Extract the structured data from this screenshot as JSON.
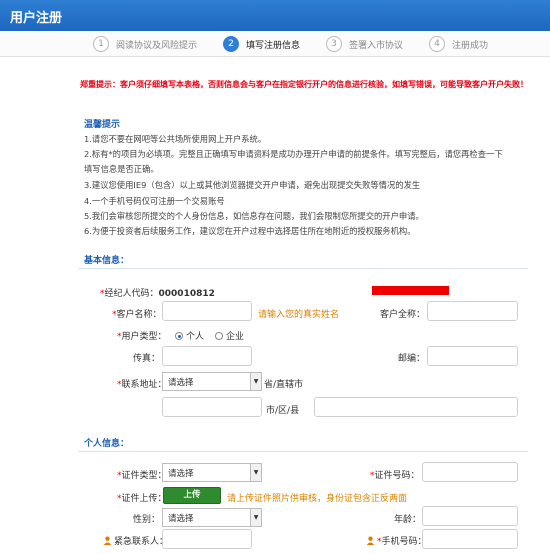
{
  "header": {
    "title": "用户注册"
  },
  "steps": [
    {
      "num": "1",
      "label": "阅读协议及风险提示"
    },
    {
      "num": "2",
      "label": "填写注册信息"
    },
    {
      "num": "3",
      "label": "签署入市协议"
    },
    {
      "num": "4",
      "label": "注册成功"
    }
  ],
  "warning": "郑重提示：客户须仔细填写本表格，否则信息会与客户在指定银行开户的信息进行核验，如填写错误，可能导致客户开户失败！",
  "tips": {
    "title": "温馨提示",
    "items": [
      "1.请您不要在网吧等公共场所使用网上开户系统。",
      "2.标有*的项目为必填项。完整且正确填写申请资料是成功办理开户申请的前提条件。填写完整后，请您再检查一下",
      "填写信息是否正确。",
      "3.建议您使用IE9（包含）以上或其他浏览器提交开户申请，避免出现提交失败等情况的发生",
      "4.一个手机号码仅可注册一个交易账号",
      "5.我们会审核您所提交的个人身份信息，如信息存在问题，我们会限制您所提交的开户申请。",
      "6.为便于投资者后续服务工作，建议您在开户过程中选择居住所在地附近的授权服务机构。"
    ]
  },
  "basic": {
    "section_title": "基本信息：",
    "broker_code_label": "经纪人代码：",
    "broker_code_value": "000010812",
    "name_label": "客户名称：",
    "name_hint": "请输入您的真实姓名",
    "fullname_label": "客户全称：",
    "type_label": "用户类型：",
    "type_personal": "个人",
    "type_company": "企业",
    "fax_label": "传真：",
    "zip_label": "邮编：",
    "address_label": "联系地址：",
    "province_select": "请选择",
    "province_suffix": "省/直辖市",
    "city_suffix": "市/区/县"
  },
  "personal": {
    "section_title": "个人信息：",
    "id_type_label": "证件类型：",
    "id_type_select": "请选择",
    "id_number_label": "证件号码：",
    "upload_label": "证件上传：",
    "upload_button": "上传",
    "upload_hint": "请上传证件照片供审核，身份证包含正反两面",
    "gender_label": "性别：",
    "gender_select": "请选择",
    "age_label": "年龄：",
    "emergency_label": "紧急联系人：",
    "phone_label": "手机号码："
  },
  "colors": {
    "brand": "#1d67bf",
    "required": "#e60012",
    "hint": "#d98200",
    "upload": "#2e8b2e"
  }
}
